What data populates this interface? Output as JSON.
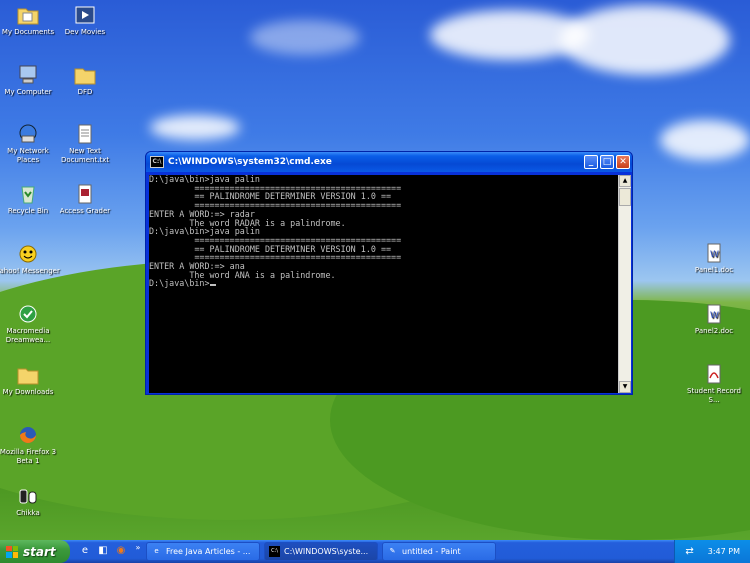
{
  "desktop_icons_left": [
    {
      "label": "My Documents",
      "icon": "folder-documents-icon"
    },
    {
      "label": "My Computer",
      "icon": "computer-icon"
    },
    {
      "label": "My Network Places",
      "icon": "network-icon"
    },
    {
      "label": "Recycle Bin",
      "icon": "recycle-bin-icon"
    },
    {
      "label": "Yahoo! Messenger",
      "icon": "yahoo-messenger-icon"
    },
    {
      "label": "Macromedia Dreamwea...",
      "icon": "dreamweaver-icon"
    },
    {
      "label": "My Downloads",
      "icon": "folder-icon"
    },
    {
      "label": "Mozilla Firefox 3 Beta 1",
      "icon": "firefox-icon"
    },
    {
      "label": "Chikka",
      "icon": "chikka-icon"
    }
  ],
  "desktop_icons_col2": [
    {
      "label": "Dev Movies",
      "icon": "movie-icon"
    },
    {
      "label": "DFD",
      "icon": "folder-icon"
    },
    {
      "label": "New Text Document.txt",
      "icon": "text-file-icon"
    },
    {
      "label": "Access Grader",
      "icon": "access-file-icon"
    }
  ],
  "desktop_icons_right": [
    {
      "label": "Panel1.doc",
      "icon": "word-doc-icon"
    },
    {
      "label": "Panel2.doc",
      "icon": "word-doc-icon"
    },
    {
      "label": "Student Record S...",
      "icon": "pdf-icon"
    }
  ],
  "cmd_window": {
    "title": "C:\\WINDOWS\\system32\\cmd.exe",
    "app_icon_text": "C:\\",
    "minimize": "_",
    "maximize": "□",
    "close": "✕",
    "scroll_up": "▲",
    "scroll_down": "▼",
    "lines": [
      "D:\\java\\bin>java palin",
      "",
      "         =========================================",
      "         == PALINDROME DETERMINER VERSION 1.0 ==",
      "         =========================================",
      "",
      "ENTER A WORD:=> radar",
      "",
      "        The word RADAR is a palindrome.",
      "",
      "D:\\java\\bin>java palin",
      "",
      "         =========================================",
      "         == PALINDROME DETERMINER VERSION 1.0 ==",
      "         =========================================",
      "",
      "ENTER A WORD:=> ana",
      "",
      "        The word ANA is a palindrome.",
      "",
      "D:\\java\\bin>"
    ]
  },
  "taskbar": {
    "start_label": "start",
    "quick_launch": [
      {
        "icon": "ie-icon",
        "glyph": "e"
      },
      {
        "icon": "show-desktop-icon",
        "glyph": "◧"
      },
      {
        "icon": "firefox-quick-icon",
        "glyph": "◉"
      }
    ],
    "overflow": "»",
    "tasks": [
      {
        "label": "Free Java Articles - ...",
        "icon": "ie-icon",
        "glyph": "e"
      },
      {
        "label": "C:\\WINDOWS\\syste...",
        "icon": "cmd-icon",
        "glyph": "C:\\"
      },
      {
        "label": "untitled - Paint",
        "icon": "paint-icon",
        "glyph": "✎"
      }
    ],
    "clock": "3:47 PM"
  }
}
